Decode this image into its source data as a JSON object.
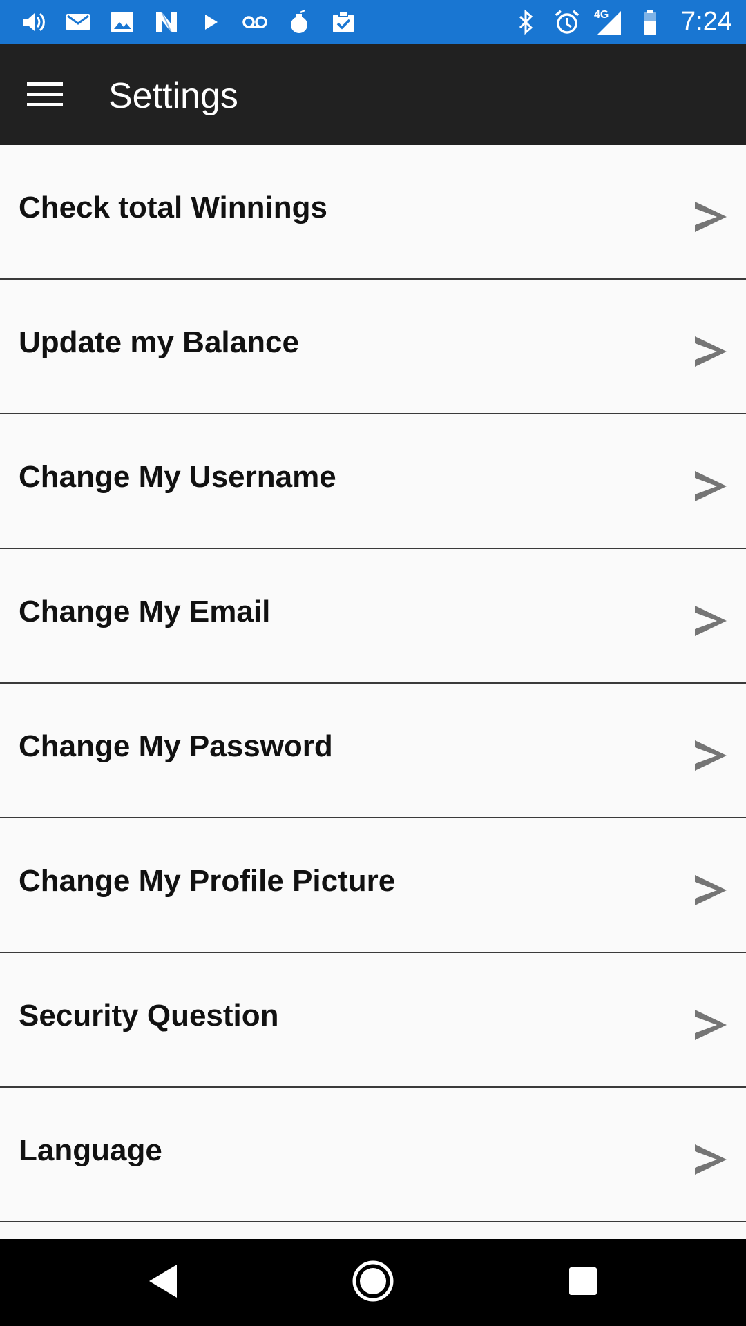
{
  "status_bar": {
    "background": "#1976d2",
    "left_icons": [
      "volume-icon",
      "mail-icon",
      "image-icon",
      "n-app-icon",
      "play-icon",
      "voicemail-icon",
      "grenade-icon",
      "clipboard-check-icon"
    ],
    "right_icons": [
      "bluetooth-icon",
      "alarm-icon",
      "signal-icon",
      "battery-icon"
    ],
    "network_label": "4G",
    "time": "7:24"
  },
  "app_bar": {
    "background": "#212121",
    "title": "Settings",
    "menu_icon": "hamburger-menu-icon"
  },
  "settings_list": {
    "chevron_color": "#757575",
    "items": [
      {
        "label": "Check total Winnings"
      },
      {
        "label": "Update my Balance"
      },
      {
        "label": "Change My Username"
      },
      {
        "label": "Change My Email"
      },
      {
        "label": "Change My Password"
      },
      {
        "label": "Change My Profile Picture"
      },
      {
        "label": "Security Question"
      },
      {
        "label": "Language"
      }
    ]
  },
  "nav_bar": {
    "background": "#000000",
    "buttons": [
      "back-icon",
      "home-icon",
      "recents-icon"
    ]
  }
}
